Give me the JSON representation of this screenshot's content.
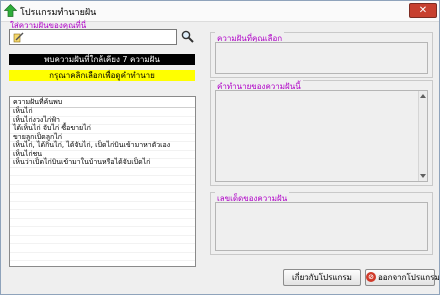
{
  "window": {
    "title": "โปรแกรมทำนายฝัน",
    "close_glyph": "✕"
  },
  "search": {
    "label": "ใส่ความฝันของคุณที่นี่",
    "value": "",
    "placeholder": ""
  },
  "banners": {
    "found": "พบความฝันที่ใกล้เคียง 7 ความฝัน",
    "hint": "กรุณาคลิกเลือกเพื่อดูคำทำนาย"
  },
  "dream_list": {
    "header": "ความฝันที่ค้นพบ",
    "items": [
      "เห็นไก่",
      "เห็นไก่งวงไก่ฟ้า",
      "ได้เห็นไก่ จับไก่ ซื้อขายไก่",
      "ขายลูกเป็ดลูกไก่",
      "เห็นไก่, ได้กินไก่, ได้จับไก่, เป็ดไก่บินเข้ามาหาตัวเอง",
      "เห็นไก่ชน",
      "เห็นว่าเป็ดไก่บินเข้ามาในบ้านหรือได้จับเป็ดไก่"
    ]
  },
  "panels": {
    "selected_label": "ความฝันที่คุณเลือก",
    "prediction_label": "คำทำนายของความฝันนี้",
    "numbers_label": "เลขเด็ดของความฝัน"
  },
  "buttons": {
    "about": "เกี่ยวกับโปรแกรม",
    "exit": "ออกจากโปรแกรม",
    "exit_glyph": "⊘"
  },
  "colors": {
    "label": "#b000c8",
    "banner_black": "#000000",
    "banner_yellow": "#ffff00",
    "close": "#c7402f"
  }
}
